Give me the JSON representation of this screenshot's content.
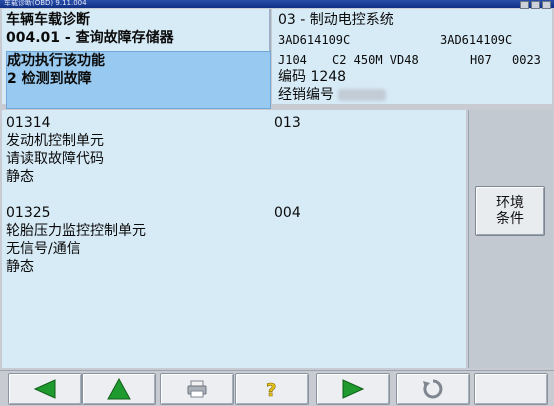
{
  "window": {
    "title": "车载诊断(OBD) 9.11.004"
  },
  "left_top": {
    "line1": "车辆车载诊断",
    "line2": "004.01 - 查询故障存储器",
    "highlight_line1": "成功执行该功能",
    "highlight_line2": "2 检测到故障"
  },
  "right_top": {
    "system": "03 - 制动电控系统",
    "part_a": "3AD614109C",
    "part_b": "3AD614109C",
    "spec_1": "J104",
    "spec_2": "C2 450M VD48",
    "spec_3": "H07",
    "spec_4": "0023",
    "code_label": "编码 1248",
    "dealer_label": "经销编号"
  },
  "faults": [
    {
      "code": "01314",
      "count": "013",
      "line1": "发动机控制单元",
      "line2": "请读取故障代码",
      "line3": "静态"
    },
    {
      "code": "01325",
      "count": "004",
      "line1": "轮胎压力监控控制单元",
      "line2": "无信号/通信",
      "line3": "静态"
    }
  ],
  "side": {
    "env_button": "环境\n条件"
  },
  "toolbar": {
    "icons": [
      "arrow-left-icon",
      "arrow-up-icon",
      "printer-icon",
      "help-icon",
      "arrow-right-icon",
      "refresh-icon"
    ],
    "colors": {
      "green": "#1e9a2e",
      "yellow": "#e5c21a",
      "grey": "#7f868f"
    }
  }
}
